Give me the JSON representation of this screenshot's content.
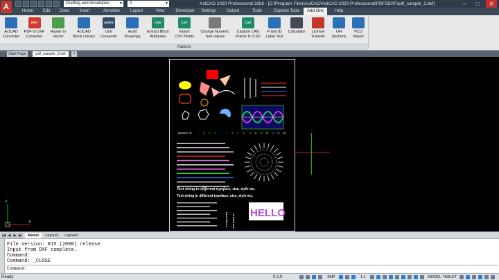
{
  "app": {
    "logo": "A",
    "title": "ActCAD 2020 Professional 32bit - [C:\\Program Files\\ActCAD\\ActCAD 2020 Professional\\PDF2DXF\\pdf_sample_3.dxf]",
    "workspace": "Drafting and Annotation",
    "layer": "0"
  },
  "menus": [
    "Home",
    "Edit",
    "Draw",
    "Insert",
    "Annotate",
    "Layout",
    "View",
    "Developer",
    "Settings",
    "Output",
    "Tools",
    "Express Tools",
    "Add-Ons",
    "Help"
  ],
  "active_menu": "Add-Ons",
  "ribbon": {
    "group_label": "Addons",
    "buttons": [
      {
        "label": "ActCAD\nConverter",
        "icon": "actcad-converter-icon",
        "badge": ""
      },
      {
        "label": "PDF to DXF\nConverter",
        "icon": "pdf-icon",
        "badge": "PDF"
      },
      {
        "label": "Raster to\nVector",
        "icon": "raster-vector-icon",
        "badge": ""
      },
      {
        "label": "ActCAD\nBlock Library",
        "icon": "block-library-icon",
        "badge": ""
      },
      {
        "label": "Unit\nConverter",
        "icon": "unit-converter-icon",
        "badge": "UNITS"
      },
      {
        "label": "Audit\nDrawings",
        "icon": "audit-icon",
        "badge": ""
      },
      {
        "label": "Extract Block\nAttributes",
        "icon": "csv-icon",
        "badge": "CSV"
      },
      {
        "label": "Import\nCSV Points",
        "icon": "csv-icon",
        "badge": "CSV"
      },
      {
        "label": "Change Numeric\nText Values",
        "icon": "numeric-text-icon",
        "badge": ""
      },
      {
        "label": "Capture CAD\nPoints To CSV",
        "icon": "csv-icon",
        "badge": "CSV"
      },
      {
        "label": "P and ID\nLabel Text",
        "icon": "pid-icon",
        "badge": ""
      },
      {
        "label": "Calculator",
        "icon": "calculator-icon",
        "badge": ""
      },
      {
        "label": "License\nTransfer",
        "icon": "license-icon",
        "badge": ""
      },
      {
        "label": "UH\nSections",
        "icon": "sections-icon",
        "badge": ""
      },
      {
        "label": "PCD\nImport",
        "icon": "pcd-icon",
        "badge": ""
      }
    ]
  },
  "doc_tabs": {
    "start": "Start Page",
    "document": "pdf_sample_3.dxf"
  },
  "layout_tabs": [
    "Model",
    "Layout1",
    "Layout2"
  ],
  "drawing": {
    "color_legend_label": "Dynamic Fill:",
    "color_numbers": [
      "1",
      "2",
      "3",
      "4",
      "5",
      "6",
      "7",
      "8",
      "9",
      "10",
      "11",
      "12",
      "13",
      "14",
      "15",
      "16"
    ],
    "headline": "Text string in different typeface, size, style etc.",
    "subline": "Text string in different typeface, size, style etc.",
    "hello": "HELLO"
  },
  "command_history": [
    "File Version: R15 (2000) release",
    "Input from DXF complete.",
    "Command:",
    "Command: _CLOSE"
  ],
  "command_prompt": "Command:",
  "status": {
    "ready": "Ready",
    "coords": "0,0,0",
    "items": [
      "ENP",
      "1:1",
      "MODEL",
      "TABLET"
    ]
  },
  "colors": {
    "titlebar": "#2f3b48",
    "menubar": "#3a4756",
    "ribbon": "#e8e8e8",
    "canvas": "#000000",
    "crosshair_x": "#c01818",
    "crosshair_y": "#17b017"
  }
}
